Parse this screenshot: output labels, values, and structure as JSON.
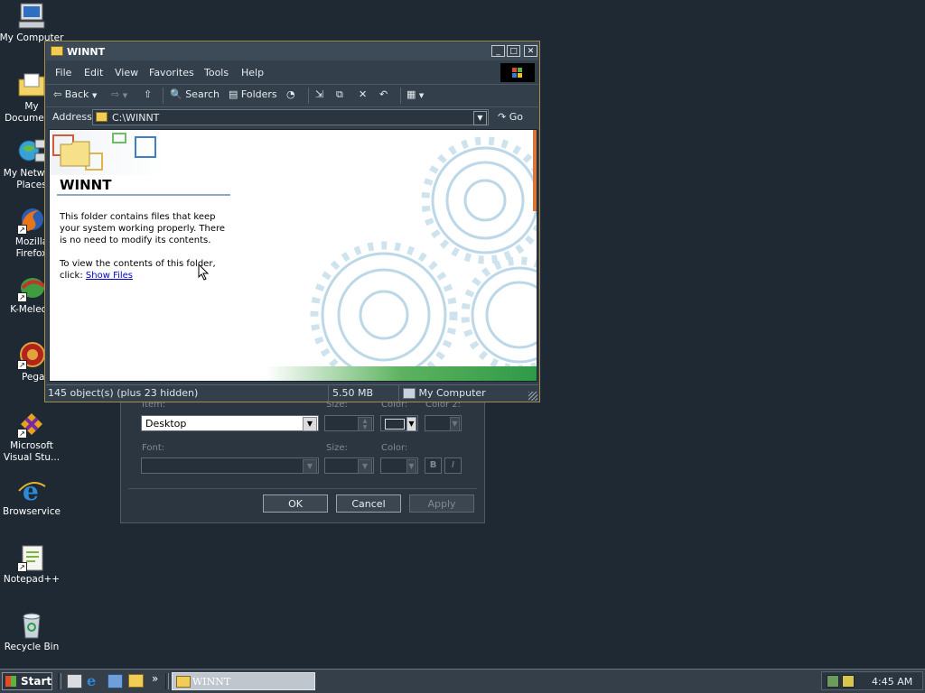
{
  "desktop_icons": [
    {
      "label": "My Computer",
      "icon": "my-computer-icon"
    },
    {
      "label": "My Documents",
      "icon": "my-documents-icon"
    },
    {
      "label": "My Network Places",
      "icon": "network-places-icon"
    },
    {
      "label": "Mozilla Firefox",
      "icon": "firefox-icon"
    },
    {
      "label": "K-Meleon",
      "icon": "k-meleon-icon"
    },
    {
      "label": "Pegasus",
      "icon": "pegasus-icon"
    },
    {
      "label": "Microsoft Visual Stu...",
      "icon": "visual-studio-icon"
    },
    {
      "label": "Browservice",
      "icon": "internet-explorer-icon"
    },
    {
      "label": "Notepad++",
      "icon": "notepad-plus-plus-icon"
    },
    {
      "label": "Recycle Bin",
      "icon": "recycle-bin-icon"
    }
  ],
  "bg_dialog": {
    "item_caption": "Item:",
    "item_value": "Desktop",
    "size_caption": "Size:",
    "color_caption": "Color:",
    "color2_caption": "Color 2:",
    "font_caption": "Font:",
    "font_size_caption": "Size:",
    "font_color_caption": "Color:",
    "bold_label": "B",
    "italic_label": "I",
    "ok_label": "OK",
    "cancel_label": "Cancel",
    "apply_label": "Apply"
  },
  "window": {
    "title": "WINNT",
    "menu": [
      "File",
      "Edit",
      "View",
      "Favorites",
      "Tools",
      "Help"
    ],
    "toolbar": {
      "back": "Back",
      "search": "Search",
      "folders": "Folders"
    },
    "address_label": "Address",
    "address_value": "C:\\WINNT",
    "go_label": "Go",
    "content": {
      "heading": "WINNT",
      "para1": "This folder contains files that keep your system working properly. There is no need to modify its contents.",
      "para2_prefix": "To view the contents of this folder, click:",
      "link": "Show Files"
    },
    "status": {
      "objects": "145 object(s) (plus 23 hidden)",
      "size": "5.50 MB",
      "zone": "My Computer"
    }
  },
  "taskbar": {
    "start_label": "Start",
    "task_item": "WINNT",
    "chevron": "»",
    "clock": "4:45 AM"
  },
  "colors": {
    "desktop": "#1f2934",
    "window_chrome": "#33404c",
    "link": "#0000cc"
  }
}
